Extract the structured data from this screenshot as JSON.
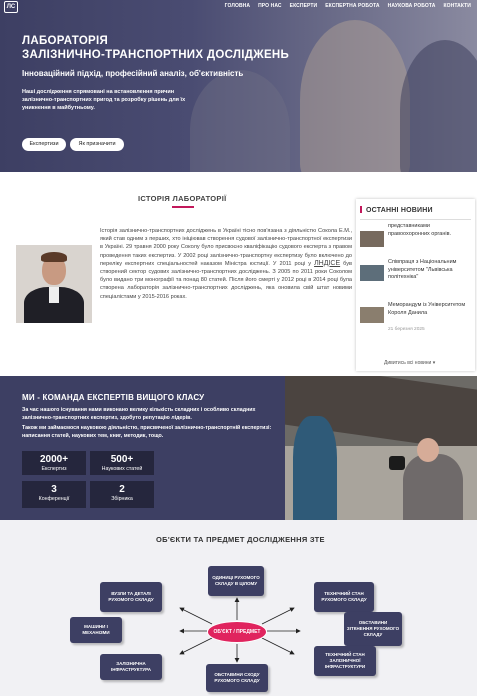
{
  "nav": {
    "logo_text": "ЛС",
    "links": [
      "ГОЛОВНА",
      "ПРО НАС",
      "ЕКСПЕРТИ",
      "ЕКСПЕРТНА РОБОТА",
      "НАУКОВА РОБОТА",
      "КОНТАКТИ"
    ]
  },
  "hero": {
    "title_line1": "ЛАБОРАТОРІЯ",
    "title_line2": "ЗАЛІЗНИЧНО-ТРАНСПОРТНИХ ДОСЛІДЖЕНЬ",
    "subtitle": "Інноваційний підхід, професійний аналіз, об'єктивність",
    "description": "Наші дослідження спрямовані на встановлення причин залізнично-транспортних пригод та розробку рішень для їх уникнення в майбутньому.",
    "buttons": [
      "Експертизи",
      "Як призначити"
    ]
  },
  "history": {
    "title": "ІСТОРІЯ ЛАБОРАТОРІЇ",
    "text_part1": "Історія залізнично-транспортних досліджень в Україні тісно пов'язана з діяльністю Сокола Е.М., який став одним з перших, хто ініціював створення судової залізнично-транспортної експертизи в Україні. 29 травня 2000 року Соколу було присвоєно кваліфікацію судового експерта з правом проведення таких експертиз. У 2002 році залізнично-транспортну експертизу було включено до переліку експертних спеціальностей наказом Міністра юстиції. У 2011 році у",
    "link": "ЛНДІСЕ",
    "text_part2": "був створений сектор судових залізнично-транспортних досліджень. З 2005 по 2011 роки Соколом було видано три монографії та понад 80 статей. Після його смерті у 2012 році в 2014 році була створена лабораторія залізнично-транспортних досліджень, яка оновила свій штат новими спеціалістами у 2015-2016 роках."
  },
  "news": {
    "title": "ОСТАННІ НОВИНИ",
    "item1_text": "представниками правоохоронних органів.",
    "item2_text": "Співпраця з Національним університетом \"Львівська політехніка\"",
    "item3_text": "Меморандум із Університетом Короля Данила",
    "item3_date": "21 березня 2025",
    "more": "Дивитись всі новини"
  },
  "team": {
    "title": "МИ - КОМАНДА ЕКСПЕРТІВ ВИЩОГО КЛАСУ",
    "desc1": "За час нашого існування нами виконано велику кількість складних і особливо складних залізнично-транспортних експертиз, здобуто репутацію лідерів.",
    "desc2": "Також ми займаємося науковою діяльністю, присвяченої залізнично-транспортній експертизі: написання статей, наукових тем, книг, методик, тощо.",
    "stats": [
      {
        "num": "2000+",
        "label": "Експертиз"
      },
      {
        "num": "500+",
        "label": "Наукових статей"
      },
      {
        "num": "3",
        "label": "Конференції"
      },
      {
        "num": "2",
        "label": "Збірника"
      }
    ]
  },
  "objects": {
    "title": "ОБ'ЄКТИ ТА ПРЕДМЕТ ДОСЛІДЖЕННЯ ЗТЕ",
    "center": "ОБ'ЄКТ / ПРЕДМЕТ",
    "boxes": [
      "ОДИНИЦІ РУХОМОГО СКЛАДУ В ЦІЛОМУ",
      "ВУЗЛИ ТА ДЕТАЛІ РУХОМОГО СКЛАДУ",
      "МАШИНИ І МЕХАНІЗМИ",
      "ЗАЛІЗНИЧНА ІНФРАСТРУКТУРА",
      "ОБСТАВИНИ СХОДУ РУХОМОГО СКЛАДУ",
      "ТЕХНІЧНИЙ СТАН РУХОМОГО СКЛАДУ",
      "ОБСТАВИНИ ЗІТКНЕННЯ РУХОМОГО СКЛАДУ",
      "ТЕХНІЧНИЙ СТАН ЗАЛІЗНИЧНОЇ ІНФРАСТРУКТУРИ"
    ]
  },
  "colors": {
    "primary": "#3d3f63",
    "accent": "#e0245e"
  }
}
